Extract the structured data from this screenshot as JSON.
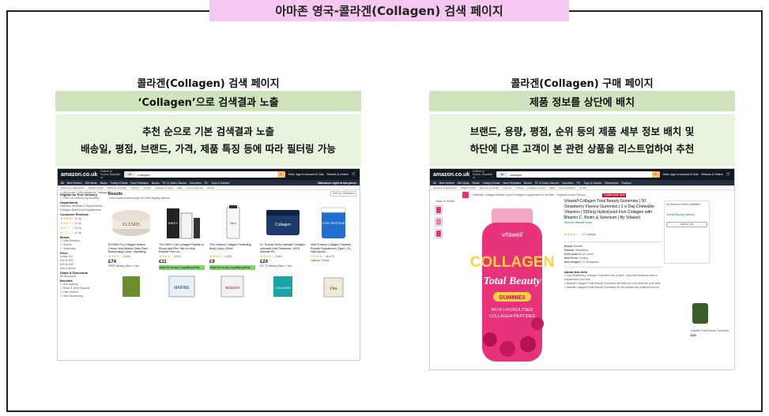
{
  "page_title": "아마존 영국-콜라겐(Collagen) 검색 페이지",
  "left_panel": {
    "heading": "콜라겐(Collagen) 검색 페이지",
    "banner": "‘Collagen’으로 검색결과 노출",
    "desc_line1": "추천 순으로 기본 검색결과 노출",
    "desc_line2": "배송일, 평점, 브랜드, 가격, 제품 특징 등에 따라 필터링 가능"
  },
  "right_panel": {
    "heading": "콜라겐(Collagen) 구매 페이지",
    "banner": "제품 정보를 상단에 배치",
    "desc_line1": "브랜드, 용량, 평점, 순위 등의 제품 세부 정보 배치 및",
    "desc_line2": "하단에 다른 고객이 본 관련 상품을 리스트업하여 추천"
  },
  "amazon": {
    "logo": "amazon.co.uk",
    "deliver_to": "Deliver to Korea, Republic of",
    "search_category": "All",
    "search_query": "collagen",
    "account": "Hello, sign in Account & Lists",
    "returns": "Returns & Orders",
    "cart": "Basket",
    "nav_items": [
      "All",
      "Best Sellers",
      "Gift Ideas",
      "Music",
      "Today's Deals",
      "New Releases",
      "Books",
      "PC & Video Games",
      "Vouchers",
      "PC",
      "Toys & Games",
      "Electronics",
      "Fashion"
    ],
    "nav_promo": "Halloween night at low prices",
    "sub_nav": [
      "Wellness & Relaxation",
      "Tablets & Pills",
      "Wellness & Health",
      "Vitamins",
      "Protein",
      "Collagen & Joints",
      "Baby",
      "Sports Nutrition",
      "Herbal"
    ]
  },
  "search_page": {
    "results_count": "1-48 of over 2,000 results for \"collagen\"",
    "sort": "Sort by: Featured",
    "results_heading": "Results",
    "results_sub": "Check each product page for other buying options.",
    "filters": [
      {
        "title": "Eligible for Free Delivery",
        "items": [
          "Free UK Delivery by Amazon"
        ]
      },
      {
        "title": "Department",
        "items": [
          "Vitamins, Minerals & Supplements",
          "Collagen Nutritional Supplements"
        ]
      },
      {
        "title": "Customer Reviews",
        "items": [
          "& Up",
          "& Up",
          "& Up",
          "& Up"
        ]
      },
      {
        "title": "Brand",
        "items": [
          "Vital Proteins",
          "Elemis",
          "Vitabiotics"
        ]
      },
      {
        "title": "Price",
        "items": [
          "Under £10",
          "£10 to £20",
          "£20 to £50",
          "£50 & above"
        ]
      },
      {
        "title": "Deals & Discounts",
        "items": [
          "All Discounts"
        ]
      },
      {
        "title": "Benefits",
        "items": [
          "Anti-Ageing",
          "Bone & Joint Support",
          "Hair Growth",
          "Skin Nourishing"
        ]
      }
    ],
    "products": [
      {
        "title": "ELEMIS Pro-Collagen Marine Cream, Anti-Wrinkle Daily Face Moisturising Lotion, Hydrating...",
        "price": "£74",
        "rating": "★★★★☆",
        "reviews": "5,626",
        "delivery": "FREE delivery Wed, 1 Nov",
        "img_label": "ELEMIS"
      },
      {
        "title": "The INKEY List Collagen Peptide to Plump and Firm Skin to Help Reduce Fine Lin...",
        "price": "£11",
        "rating": "★★★★☆",
        "reviews": "4,019",
        "delivery": "Save 5% on any 4 qualifying items",
        "img_label": "INKEY"
      },
      {
        "title": "The Outdoor Collagen Perfecting Body Lotion 200ml",
        "price": "£9",
        "rating": "★★★★☆",
        "reviews": "1,228",
        "delivery": "Save 5% on any 4 qualifying items",
        "img_label": "lotion"
      },
      {
        "title": "Dr. Scholls Nutrio Intimate Collagen Intensive Hair Treatment, 100% Intimate Pe...",
        "price": "£24",
        "rating": "★★★★☆",
        "reviews": "2,661",
        "delivery": "£17.75 delivery Wed, 1 Nov",
        "img_label": "Collagen"
      },
      {
        "title": "Vital Proteins Collagen Peptides Powder Supplement (Type I, III) - Hydrolyzed...",
        "price": "",
        "rating": "★★★★☆",
        "reviews": "46,579",
        "delivery": "Options: 3 sizes",
        "img_label": "VITAL PROTEINS"
      }
    ],
    "second_row": [
      "MARINE",
      "BIOGAN",
      "COLLAGEN",
      "Ora"
    ]
  },
  "product_page": {
    "promo_banner": "Vitabiotic Collagen Marine Liquid Collagen Supplement for Women - Original Lemon Flavour",
    "back_link": "‹ Back to results",
    "title": "Vitawell Collagen Total Beauty Gummies | 50 Strawberry Flavour Gummies | 1 a Day Chewable Vitamins | 500mg Hydrolysed Fish Collagen with Vitamin C, Biotin & Selenium | By Vitawell",
    "store": "Visit the Vitawell Store",
    "rating": "★★★★☆",
    "ratings_count": "171 ratings",
    "specs": [
      {
        "k": "Brand",
        "v": "Vitawell"
      },
      {
        "k": "Flavour",
        "v": "Strawberry"
      },
      {
        "k": "Unit count",
        "v": "50.00 count"
      },
      {
        "k": "Item Form",
        "v": "Gummy"
      },
      {
        "k": "Item weight",
        "v": "0.17 Kilograms"
      }
    ],
    "about_title": "About this item",
    "about_items": [
      "Your Strawberry Collagen Gummies are a quick, easy and delicious way to supplement your diet.",
      "Vitawell Collagen Total Beauty Gummies will help you look and feel your best.",
      "Vitawell Collagen Total Beauty Gummies do not contain any artificial colours."
    ],
    "jar_brand": "vitawell",
    "jar_word1": "COLLAGEN",
    "jar_word2": "Total Beauty",
    "jar_pill": "GUMMIES",
    "jar_line1": "WITH HYDROLYSED",
    "jar_line2": "COLLAGEN PEPTIDES",
    "buy_note": "No featured offers available",
    "buy_link": "See All Buying Options",
    "add_list": "Add to List",
    "related_title": "Vitawell Total Beauty Gummies",
    "related_price": "£20"
  },
  "colors": {
    "title_tab": "#f4c8f0",
    "banner": "#cfe3bd",
    "desc": "#e9f4df",
    "amazon_dark": "#131921",
    "amazon_nav": "#232f3e",
    "amazon_orange": "#febd69",
    "jar_pink": "#e8337a"
  }
}
